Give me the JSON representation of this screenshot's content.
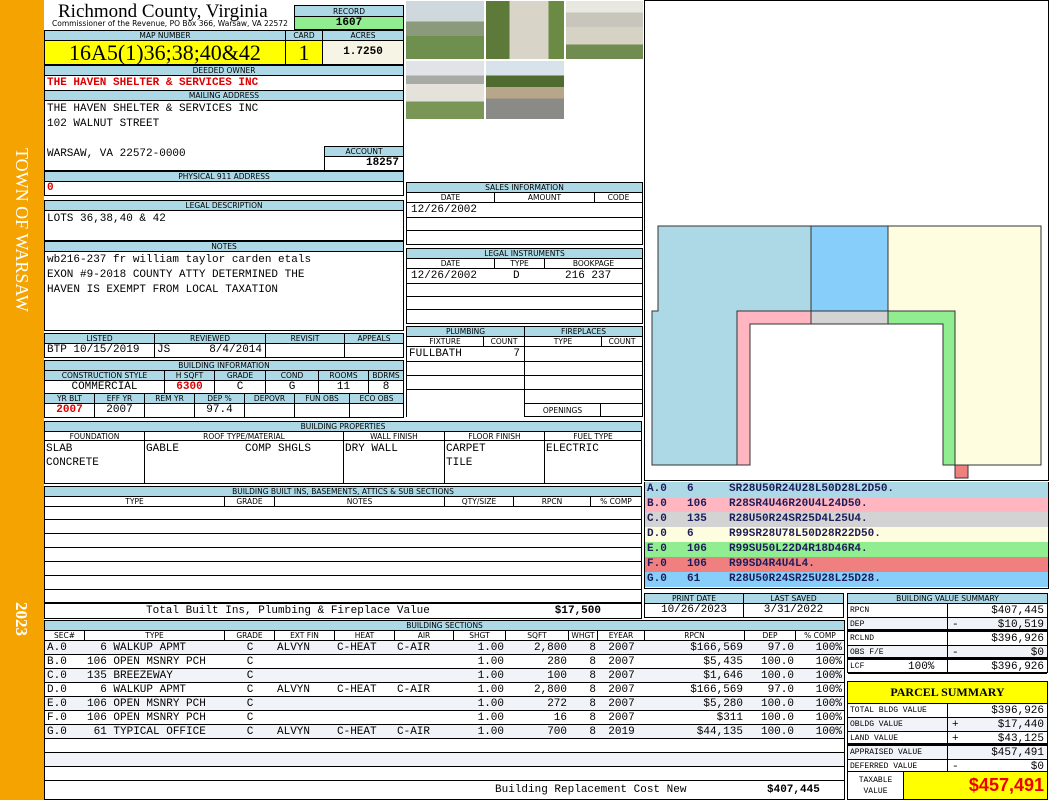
{
  "side": {
    "town": "TOWN OF WARSAW",
    "year": "2023"
  },
  "header": {
    "county_title": "Richmond County, Virginia",
    "subtitle": "Commissioner of the Revenue, PO Box 366, Warsaw, VA 22572",
    "record_label": "RECORD",
    "record": "1607",
    "map_label": "MAP NUMBER",
    "map_number": "16A5(1)36;38;40&42",
    "card_label": "CARD",
    "card": "1",
    "acres_label": "ACRES",
    "acres": "1.7250"
  },
  "owner": {
    "label": "DEEDED OWNER",
    "name": "THE HAVEN SHELTER & SERVICES INC"
  },
  "mailing": {
    "label": "MAILING ADDRESS",
    "line1": "THE HAVEN SHELTER & SERVICES INC",
    "line2": "102 WALNUT STREET",
    "line3": "WARSAW, VA 22572-0000",
    "account_label": "ACCOUNT",
    "account": "18257"
  },
  "physical": {
    "label": "PHYSICAL 911 ADDRESS",
    "value": "0"
  },
  "legal": {
    "label": "LEGAL DESCRIPTION",
    "text": "LOTS 36,38,40 & 42"
  },
  "notes": {
    "label": "NOTES",
    "line1": "wb216-237 fr william taylor carden etals",
    "line2": "EXON #9-2018 COUNTY ATTY DETERMINED THE",
    "line3": "HAVEN IS EXEMPT FROM LOCAL TAXATION"
  },
  "listing": {
    "listed_label": "LISTED",
    "reviewed_label": "REVIEWED",
    "revisit_label": "REVISIT",
    "appeals_label": "APPEALS",
    "listed": "BTP 10/15/2019",
    "reviewed_by": "JS",
    "reviewed_date": "8/4/2014"
  },
  "building_info": {
    "label": "BUILDING INFORMATION",
    "style_label": "CONSTRUCTION STYLE",
    "hsqft_label": "H SQFT",
    "grade_label": "GRADE",
    "cond_label": "COND",
    "rooms_label": "ROOMS",
    "bdrms_label": "BDRMS",
    "style": "COMMERCIAL",
    "hsqft": "6300",
    "grade": "C",
    "cond": "G",
    "rooms": "11",
    "bdrms": "8",
    "yrblt_label": "YR BLT",
    "effyr_label": "EFF YR",
    "remyr_label": "REM YR",
    "dep_label": "DEP %",
    "depovr_label": "DEPOVR",
    "funobs_label": "FUN OBS",
    "ecoobs_label": "ECO OBS",
    "yrblt": "2007",
    "effyr": "2007",
    "dep": "97.4"
  },
  "properties": {
    "label": "BUILDING PROPERTIES",
    "foundation_label": "FOUNDATION",
    "roof_label": "ROOF TYPE/MATERIAL",
    "wall_label": "WALL FINISH",
    "floor_label": "FLOOR FINISH",
    "fuel_label": "FUEL TYPE",
    "foundation1": "SLAB",
    "foundation2": "CONCRETE",
    "roof_type": "GABLE",
    "roof_material": "COMP SHGLS",
    "wall": "DRY WALL",
    "floor1": "CARPET",
    "floor2": "TILE",
    "fuel": "ELECTRIC"
  },
  "builtins": {
    "label": "BUILDING BUILT INS, BASEMENTS, ATTICS & SUB SECTIONS",
    "columns": [
      "TYPE",
      "GRADE",
      "NOTES",
      "QTY/SIZE",
      "RPCN",
      "% COMP"
    ],
    "total_label": "Total Built Ins, Plumbing & Fireplace Value",
    "total": "$17,500"
  },
  "sections": {
    "label": "BUILDING SECTIONS",
    "columns": [
      "SEC#",
      "TYPE",
      "GRADE",
      "EXT FIN",
      "HEAT",
      "AIR",
      "SHGT",
      "SQFT",
      "WHGT",
      "EYEAR",
      "RPCN",
      "DEP",
      "% COMP"
    ],
    "rows": [
      [
        "A.0",
        "  6 WALKUP APMT",
        "C",
        "ALVYN",
        "C-HEAT",
        "C-AIR",
        "1.00",
        "2,800",
        "8",
        "2007",
        "$166,569",
        "97.0",
        "100%"
      ],
      [
        "B.0",
        "106 OPEN MSNRY PCH",
        "C",
        "",
        "",
        "",
        "1.00",
        "280",
        "8",
        "2007",
        "$5,435",
        "100.0",
        "100%"
      ],
      [
        "C.0",
        "135 BREEZEWAY",
        "C",
        "",
        "",
        "",
        "1.00",
        "100",
        "8",
        "2007",
        "$1,646",
        "100.0",
        "100%"
      ],
      [
        "D.0",
        "  6 WALKUP APMT",
        "C",
        "ALVYN",
        "C-HEAT",
        "C-AIR",
        "1.00",
        "2,800",
        "8",
        "2007",
        "$166,569",
        "97.0",
        "100%"
      ],
      [
        "E.0",
        "106 OPEN MSNRY PCH",
        "C",
        "",
        "",
        "",
        "1.00",
        "272",
        "8",
        "2007",
        "$5,280",
        "100.0",
        "100%"
      ],
      [
        "F.0",
        "106 OPEN MSNRY PCH",
        "C",
        "",
        "",
        "",
        "1.00",
        "16",
        "8",
        "2007",
        "$311",
        "100.0",
        "100%"
      ],
      [
        "G.0",
        " 61 TYPICAL OFFICE",
        "C",
        "ALVYN",
        "C-HEAT",
        "C-AIR",
        "1.00",
        "700",
        "8",
        "2019",
        "$44,135",
        "100.0",
        "100%"
      ]
    ],
    "replacement_label": "Building Replacement Cost New",
    "replacement": "$407,445"
  },
  "sales": {
    "label": "SALES INFORMATION",
    "columns": [
      "DATE",
      "AMOUNT",
      "CODE"
    ],
    "date": "12/26/2002"
  },
  "instruments": {
    "label": "LEGAL INSTRUMENTS",
    "columns": [
      "DATE",
      "TYPE",
      "BOOKPAGE"
    ],
    "date": "12/26/2002",
    "type": "D",
    "bookpage": "216 237"
  },
  "plumbing": {
    "label": "PLUMBING",
    "columns": [
      "FIXTURE",
      "COUNT"
    ],
    "fixture": "FULLBATH",
    "count": "7"
  },
  "fireplaces": {
    "label": "FIREPLACES",
    "columns": [
      "TYPE",
      "COUNT"
    ],
    "openings_label": "OPENINGS"
  },
  "sketch_legend": [
    {
      "sec": "A.0",
      "code": "6",
      "vector": "SR28U50R24U28L50D28L2D50.",
      "color": "#add8e6"
    },
    {
      "sec": "B.0",
      "code": "106",
      "vector": "R28SR4U46R20U4L24D50.",
      "color": "#ffb6c1"
    },
    {
      "sec": "C.0",
      "code": "135",
      "vector": "R28U50R24SR25D4L25U4.",
      "color": "#d3d3d3"
    },
    {
      "sec": "D.0",
      "code": "6",
      "vector": "R99SR28U78L50D28R22D50.",
      "color": "#fffde0"
    },
    {
      "sec": "E.0",
      "code": "106",
      "vector": "R99SU50L22D4R18D46R4.",
      "color": "#90ee90"
    },
    {
      "sec": "F.0",
      "code": "106",
      "vector": "R99SD4R4U4L4.",
      "color": "#f08080"
    },
    {
      "sec": "G.0",
      "code": "61",
      "vector": "R28U50R24SR25U28L25D28.",
      "color": "#87cefa"
    }
  ],
  "dates": {
    "print_label": "PRINT DATE",
    "print": "10/26/2023",
    "saved_label": "LAST SAVED",
    "saved": "3/31/2022"
  },
  "value_summary": {
    "label": "BUILDING VALUE SUMMARY",
    "rows": [
      {
        "label": "RPCN",
        "extra": "",
        "sign": "",
        "value": "$407,445"
      },
      {
        "label": "DEP",
        "extra": "",
        "sign": "-",
        "value": "$10,519"
      },
      {
        "label": "RCLND",
        "extra": "",
        "sign": "",
        "value": "$396,926"
      },
      {
        "label": "OBS F/E",
        "extra": "",
        "sign": "-",
        "value": "$0"
      },
      {
        "label": "LCF",
        "extra": "100%",
        "sign": "",
        "value": "$396,926"
      }
    ]
  },
  "parcel_summary": {
    "label": "PARCEL SUMMARY",
    "rows": [
      {
        "label": "TOTAL BLDG VALUE",
        "sign": "",
        "value": "$396,926"
      },
      {
        "label": "OBLDG VALUE",
        "sign": "+",
        "value": "$17,440"
      },
      {
        "label": "LAND VALUE",
        "sign": "+",
        "value": "$43,125"
      },
      {
        "label": "APPRAISED VALUE",
        "sign": "",
        "value": "$457,491"
      },
      {
        "label": "DEFERRED VALUE",
        "sign": "-",
        "value": "$0"
      }
    ],
    "taxable_label": "TAXABLE VALUE",
    "taxable": "$457,491"
  }
}
